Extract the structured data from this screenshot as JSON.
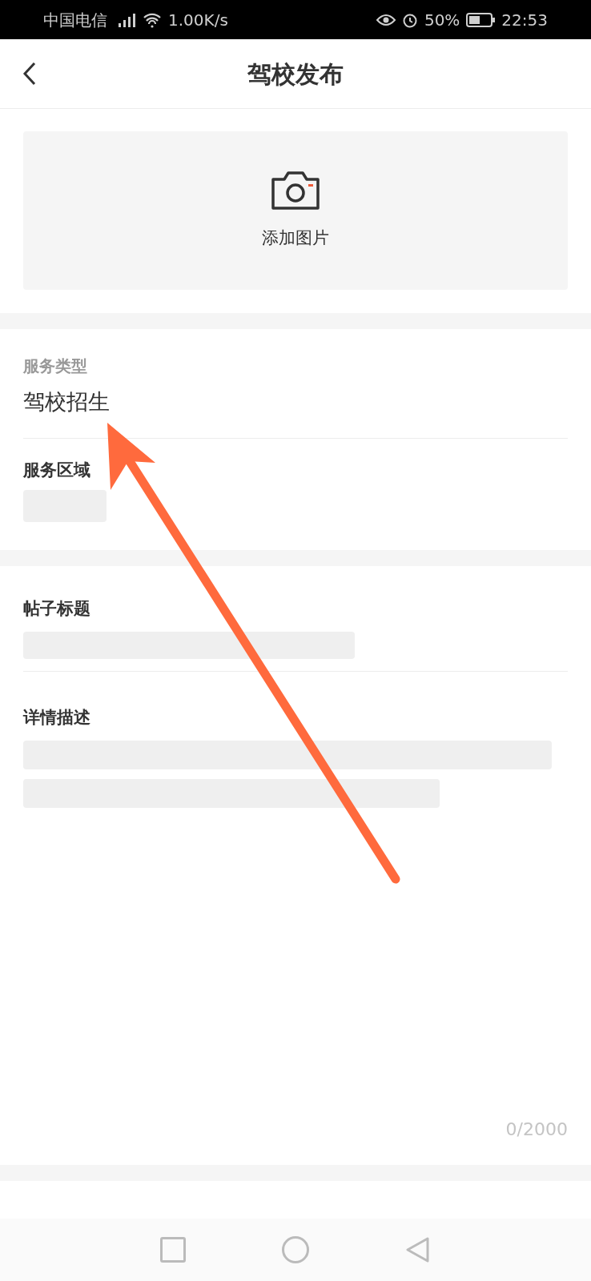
{
  "status_bar": {
    "carrier": "中国电信",
    "speed": "1.00K/s",
    "battery": "50%",
    "time": "22:53"
  },
  "header": {
    "title": "驾校发布"
  },
  "photo": {
    "label": "添加图片"
  },
  "service_type": {
    "label": "服务类型",
    "value": "驾校招生"
  },
  "service_area": {
    "label": "服务区域"
  },
  "post_title": {
    "label": "帖子标题"
  },
  "description": {
    "label": "详情描述",
    "counter": "0/2000"
  }
}
